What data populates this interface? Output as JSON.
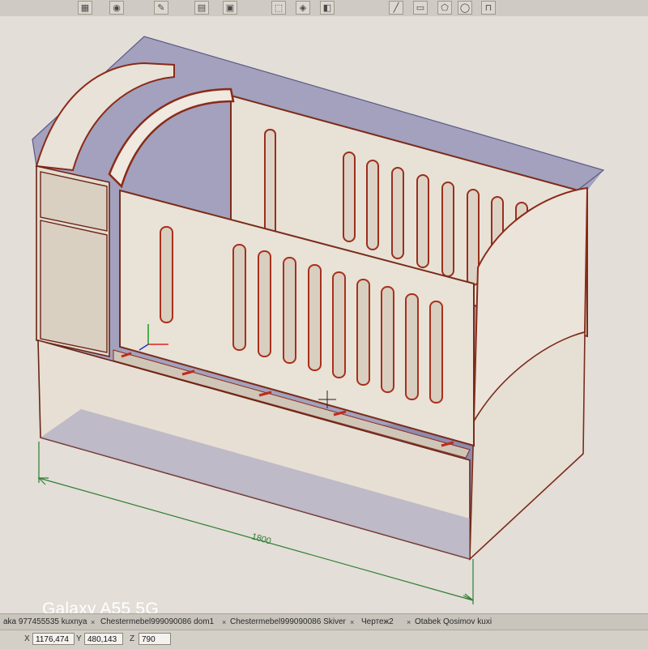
{
  "toolbar": {
    "icons": [
      "grid-icon",
      "palette-icon",
      "pencil-icon",
      "layers-icon",
      "cursor-icon",
      "select-icon",
      "paint-icon",
      "line-tool-icon",
      "shape-tool-icon",
      "frame-tool-icon"
    ]
  },
  "drawing": {
    "dimension_label": "1800",
    "colors": {
      "panel": "#e6ded3",
      "edge": "#8a2a18",
      "bbox": "#6d6d9a",
      "dimension": "#2e7d32"
    }
  },
  "watermark": "Galaxy A55 5G",
  "tabs": [
    {
      "label": "aka 977455535 kuxnya"
    },
    {
      "label": "Chestermebel999090086 dom1"
    },
    {
      "label": "Chestermebel999090086 Skiver"
    },
    {
      "label": "Чертеж2"
    },
    {
      "label": "Otabek Qosimov kuxi"
    }
  ],
  "coords": {
    "x_label": "X",
    "x_value": "1176,474",
    "y_label": "Y",
    "y_value": "480,143",
    "z_label": "Z",
    "z_value": "790"
  }
}
